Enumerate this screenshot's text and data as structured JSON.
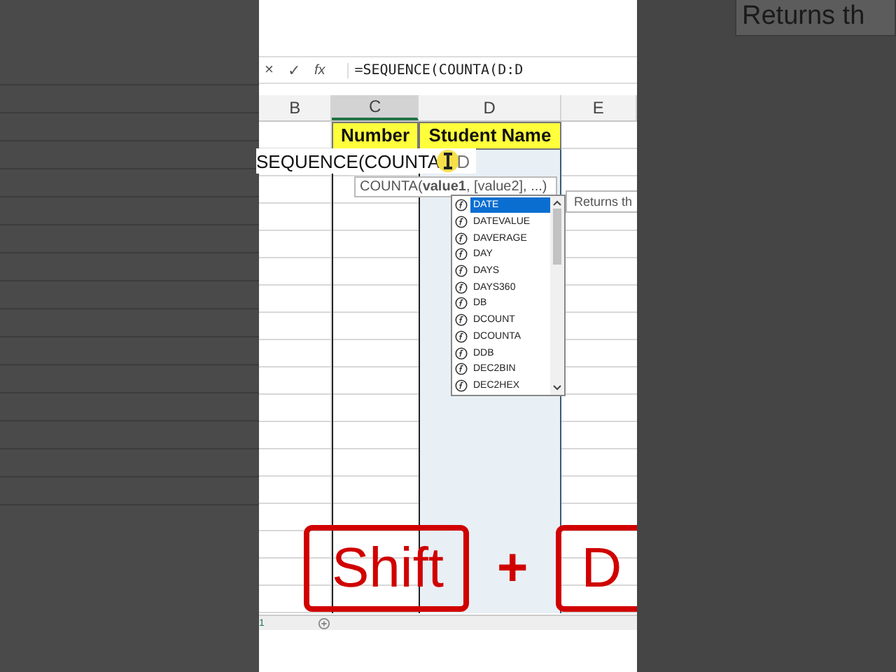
{
  "formula_bar": {
    "cancel": "×",
    "enter": "✓",
    "fx": "fx",
    "formula": "=SEQUENCE(COUNTA(D:D"
  },
  "columns": [
    "B",
    "C",
    "D",
    "E"
  ],
  "table_headers": [
    "Number",
    "Student Name"
  ],
  "editing_text": {
    "before": "SEQUENCE(COUNTA",
    "after": "D"
  },
  "function_hint": "COUNTA(**value1**, [value2], ...)",
  "autocomplete": [
    {
      "label": "DATE",
      "selected": true
    },
    {
      "label": "DATEVALUE",
      "selected": false
    },
    {
      "label": "DAVERAGE",
      "selected": false
    },
    {
      "label": "DAY",
      "selected": false
    },
    {
      "label": "DAYS",
      "selected": false
    },
    {
      "label": "DAYS360",
      "selected": false
    },
    {
      "label": "DB",
      "selected": false
    },
    {
      "label": "DCOUNT",
      "selected": false
    },
    {
      "label": "DCOUNTA",
      "selected": false
    },
    {
      "label": "DDB",
      "selected": false
    },
    {
      "label": "DEC2BIN",
      "selected": false
    },
    {
      "label": "DEC2HEX",
      "selected": false
    }
  ],
  "side_tooltip": "Returns th",
  "background_tooltip": "Returns th",
  "sheet_bar": {
    "row_label": "1"
  },
  "key_overlay": {
    "keys": [
      "Shift",
      "D"
    ],
    "separator": "+"
  }
}
